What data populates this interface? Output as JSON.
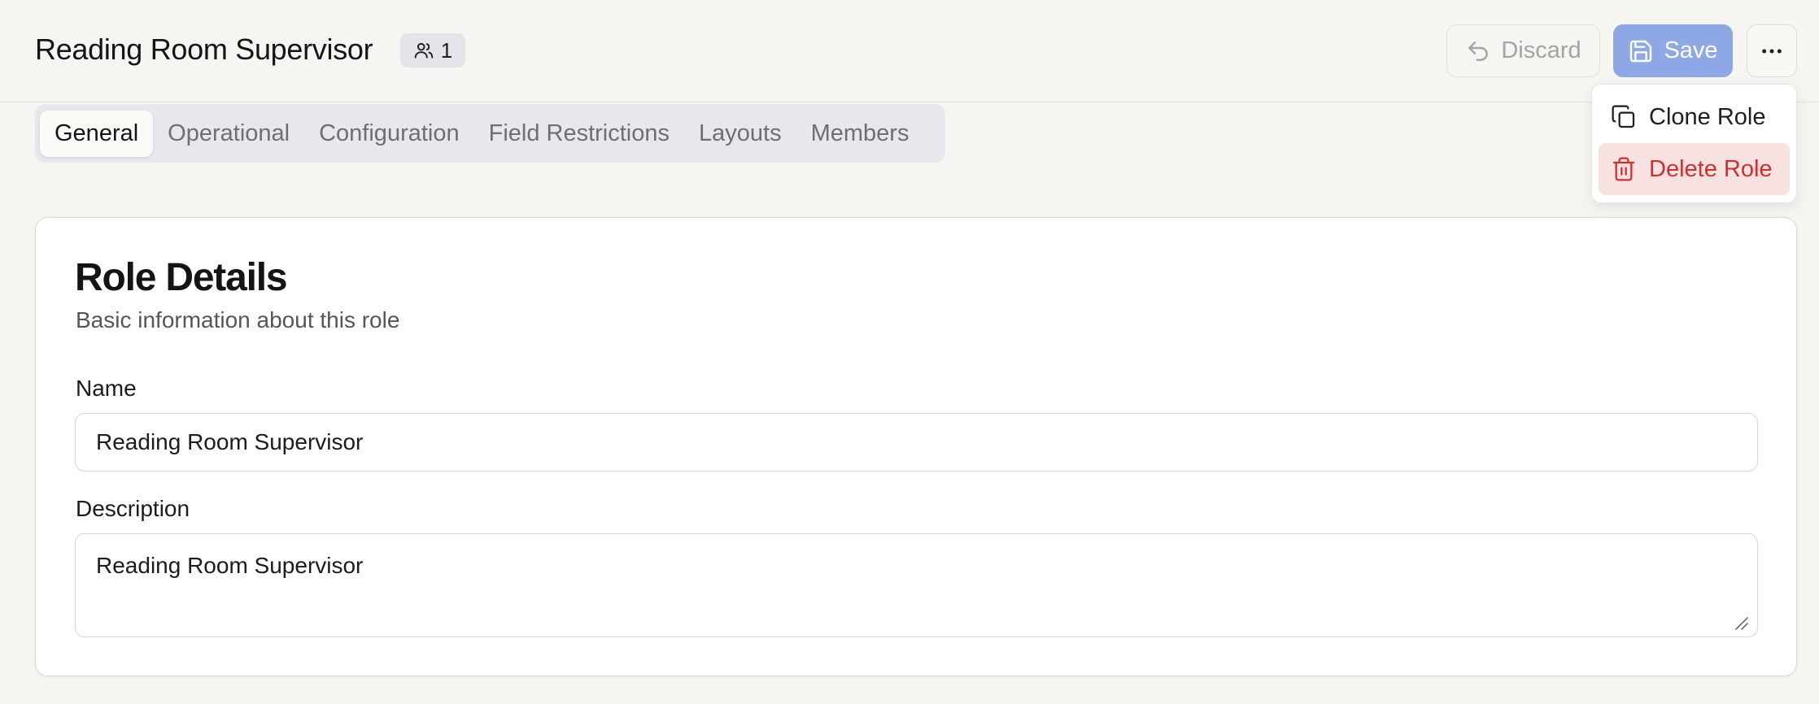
{
  "header": {
    "title": "Reading Room Supervisor",
    "member_count": "1",
    "member_icon": "users-icon",
    "discard_label": "Discard",
    "discard_icon": "undo-icon",
    "save_label": "Save",
    "save_icon": "floppy-disk-icon",
    "more_icon": "more-horizontal-icon"
  },
  "tabs": [
    {
      "label": "General",
      "active": true
    },
    {
      "label": "Operational",
      "active": false
    },
    {
      "label": "Configuration",
      "active": false
    },
    {
      "label": "Field Restrictions",
      "active": false
    },
    {
      "label": "Layouts",
      "active": false
    },
    {
      "label": "Members",
      "active": false
    }
  ],
  "card": {
    "title": "Role Details",
    "subtitle": "Basic information about this role",
    "name_label": "Name",
    "name_value": "Reading Room Supervisor",
    "description_label": "Description",
    "description_value": "Reading Room Supervisor"
  },
  "menu": {
    "clone_label": "Clone Role",
    "clone_icon": "copy-icon",
    "delete_label": "Delete Role",
    "delete_icon": "trash-icon"
  },
  "colors": {
    "background": "#f6f5f1",
    "save_button": "#8ea8e6",
    "delete_text": "#d12f2f",
    "delete_highlight": "#f8e1e1",
    "tab_bar": "#e6e8ed"
  }
}
